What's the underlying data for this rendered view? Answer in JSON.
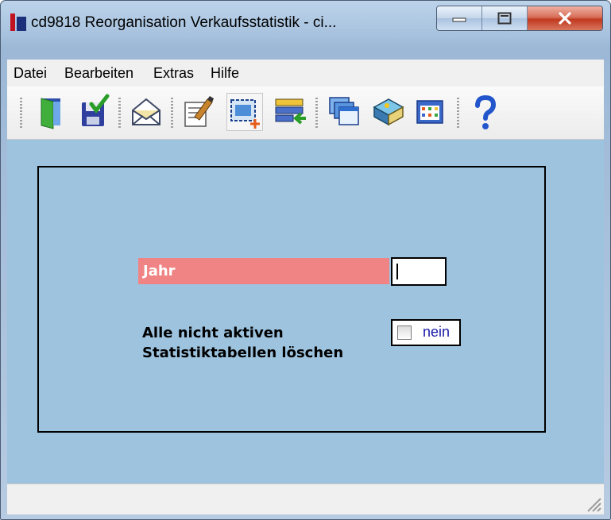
{
  "window": {
    "title": "cd9818 Reorganisation Verkaufsstatistik - ci...",
    "app_icon": "red-blue-app-icon",
    "caption_buttons": [
      "minimize-icon",
      "maximize-icon",
      "close-icon"
    ]
  },
  "menu": {
    "items": [
      {
        "label": "Datei"
      },
      {
        "label": "Bearbeiten"
      },
      {
        "label": "Extras"
      },
      {
        "label": "Hilfe"
      }
    ]
  },
  "toolbar": {
    "buttons": [
      {
        "icon": "exit-door-icon"
      },
      {
        "icon": "save-check-icon"
      },
      {
        "icon": "mail-envelope-icon"
      },
      {
        "icon": "edit-document-icon"
      },
      {
        "icon": "new-record-icon"
      },
      {
        "icon": "import-list-icon"
      },
      {
        "icon": "windows-icon"
      },
      {
        "icon": "book-icon"
      },
      {
        "icon": "table-grid-icon"
      },
      {
        "icon": "help-icon"
      }
    ]
  },
  "form": {
    "year_label": "Jahr",
    "year_value": "",
    "delete_label_line1": "Alle nicht aktiven",
    "delete_label_line2": "Statistiktabellen löschen",
    "delete_checked": false,
    "delete_value_label": "nein"
  },
  "colors": {
    "client_background": "#9dc3df",
    "label_highlight": "#f08484",
    "checkbox_text": "#1a1aa8"
  },
  "statusbar": {
    "text": ""
  }
}
